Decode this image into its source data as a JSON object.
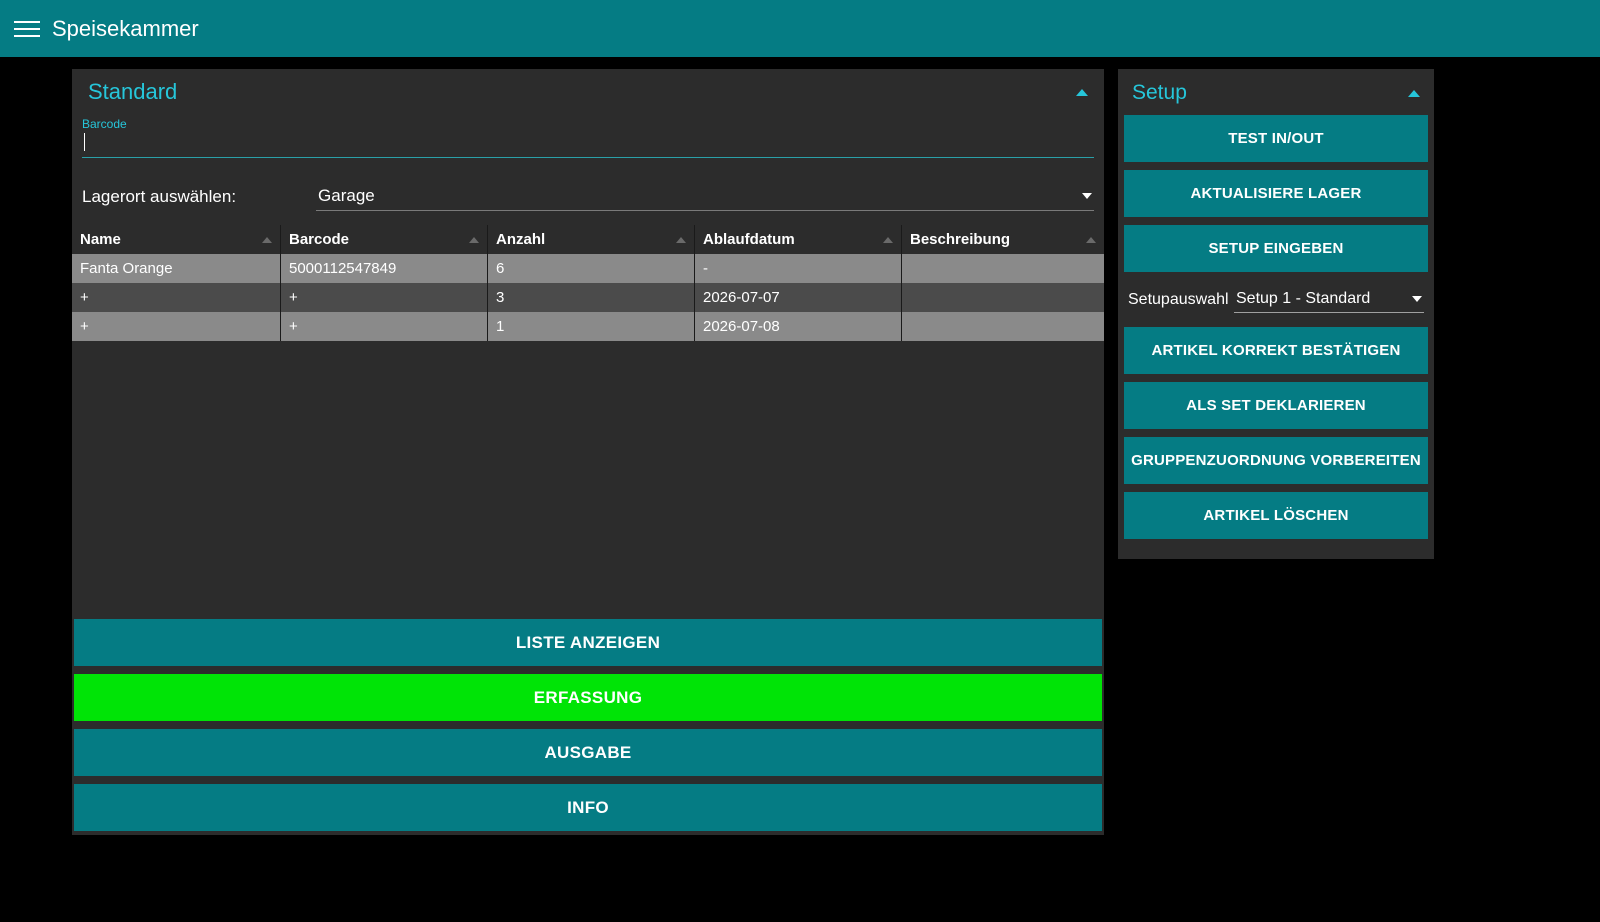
{
  "header": {
    "title": "Speisekammer"
  },
  "left": {
    "title": "Standard",
    "barcode_label": "Barcode",
    "barcode_value": "",
    "lagerort_label": "Lagerort auswählen:",
    "lagerort_value": "Garage",
    "columns": {
      "name": "Name",
      "barcode": "Barcode",
      "anzahl": "Anzahl",
      "ablauf": "Ablaufdatum",
      "beschreibung": "Beschreibung"
    },
    "rows": [
      {
        "name": "Fanta Orange",
        "barcode": "5000112547849",
        "anzahl": "6",
        "ablauf": "-",
        "beschreibung": ""
      },
      {
        "name": "+",
        "barcode": "+",
        "anzahl": "3",
        "ablauf": "2026-07-07",
        "beschreibung": ""
      },
      {
        "name": "+",
        "barcode": "+",
        "anzahl": "1",
        "ablauf": "2026-07-08",
        "beschreibung": ""
      }
    ],
    "buttons": {
      "liste": "LISTE ANZEIGEN",
      "erfassung": "ERFASSUNG",
      "ausgabe": "AUSGABE",
      "info": "INFO"
    }
  },
  "right": {
    "title": "Setup",
    "buttons": {
      "test": "TEST IN/OUT",
      "aktualisiere": "AKTUALISIERE LAGER",
      "setup_eingeben": "SETUP EINGEBEN",
      "artikel_bestaetigen": "ARTIKEL KORREKT BESTÄTIGEN",
      "als_set": "ALS SET DEKLARIEREN",
      "gruppen": "GRUPPENZUORDNUNG VORBEREITEN",
      "loeschen": "ARTIKEL LÖSCHEN"
    },
    "setup_label": "Setupauswahl",
    "setup_value": "Setup 1 - Standard"
  }
}
